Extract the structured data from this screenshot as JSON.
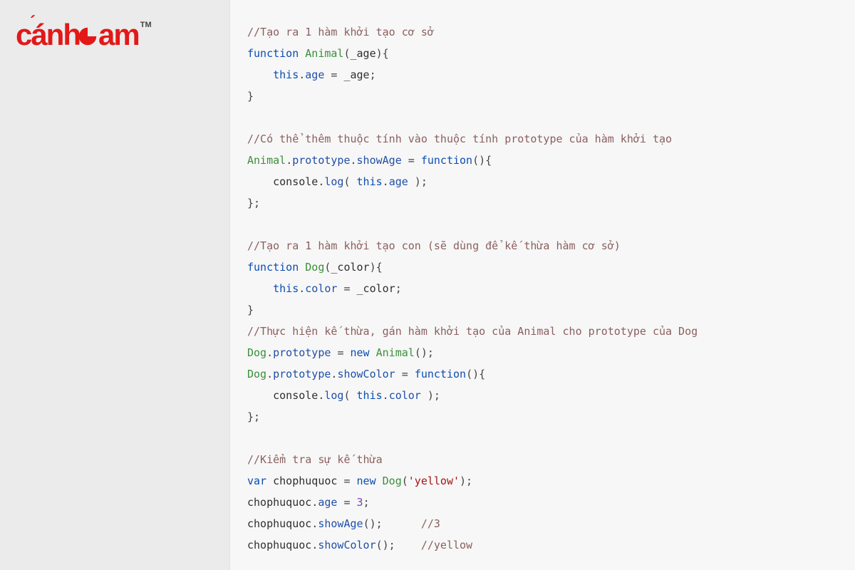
{
  "logo": {
    "text": "cánh",
    "text2": "am",
    "tm": "TM"
  },
  "code": {
    "l1_comment": "//Tạo ra 1 hàm khởi tạo cơ sở",
    "l2_kw": "function",
    "l2_name": "Animal",
    "l2_param": "_age",
    "l3_this": "this",
    "l3_prop": "age",
    "l3_rhs": "_age",
    "l5_comment": "//Có thể thêm thuộc tính vào thuộc tính prototype của hàm khởi tạo",
    "l6_obj": "Animal",
    "l6_p1": "prototype",
    "l6_p2": "showAge",
    "l6_kw": "function",
    "l7_call1": "console",
    "l7_call2": "log",
    "l7_this": "this",
    "l7_prop": "age",
    "l9_comment": "//Tạo ra 1 hàm khởi tạo con (sẽ dùng để kế thừa hàm cơ sở)",
    "l10_kw": "function",
    "l10_name": "Dog",
    "l10_param": "_color",
    "l11_this": "this",
    "l11_prop": "color",
    "l11_rhs": "_color",
    "l13_comment": "//Thực hiện kế thừa, gán hàm khởi tạo của Animal cho prototype của Dog",
    "l14_obj": "Dog",
    "l14_p1": "prototype",
    "l14_kw": "new",
    "l14_ctor": "Animal",
    "l15_obj": "Dog",
    "l15_p1": "prototype",
    "l15_p2": "showColor",
    "l15_kw": "function",
    "l16_call1": "console",
    "l16_call2": "log",
    "l16_this": "this",
    "l16_prop": "color",
    "l18_comment": "//Kiểm tra sự kế thừa",
    "l19_kw": "var",
    "l19_name": "chophuquoc",
    "l19_new": "new",
    "l19_ctor": "Dog",
    "l19_arg": "'yellow'",
    "l20_obj": "chophuquoc",
    "l20_prop": "age",
    "l20_val": "3",
    "l21_obj": "chophuquoc",
    "l21_m": "showAge",
    "l21_c": "//3",
    "l22_obj": "chophuquoc",
    "l22_m": "showColor",
    "l22_c": "//yellow"
  }
}
